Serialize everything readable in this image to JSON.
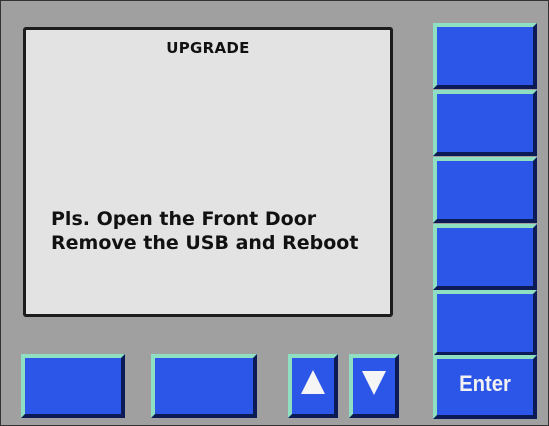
{
  "screen": {
    "title": "UPGRADE",
    "message_line1": "Pls. Open the Front Door",
    "message_line2": "Remove the USB and Reboot"
  },
  "side_keys": [
    "",
    "",
    "",
    "",
    ""
  ],
  "bottom_keys": {
    "up_icon": "up-arrow-icon",
    "down_icon": "down-arrow-icon",
    "enter_label": "Enter"
  },
  "colors": {
    "key_face": "#2b56e8",
    "key_highlight": "#8fe0c3",
    "screen_bg": "#e3e3e3",
    "panel_bg": "#a0a0a0"
  }
}
